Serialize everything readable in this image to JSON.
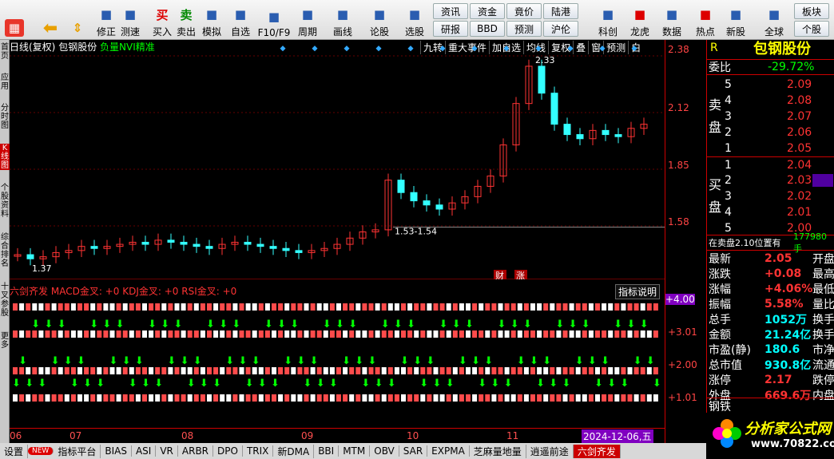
{
  "toolbar": {
    "items": [
      {
        "label": "修正",
        "icon": "edit-icon"
      },
      {
        "label": "测速",
        "icon": "speed-icon"
      },
      {
        "label": "买入",
        "icon": "buy-icon",
        "glyph": "买"
      },
      {
        "label": "卖出",
        "icon": "sell-icon",
        "glyph": "卖"
      },
      {
        "label": "模拟",
        "icon": "hammer-icon"
      },
      {
        "label": "自选",
        "icon": "star-icon"
      },
      {
        "label": "F10/F9",
        "icon": "f10-icon"
      },
      {
        "label": "周期",
        "icon": "clock-icon"
      },
      {
        "label": "画线",
        "icon": "pen-icon"
      },
      {
        "label": "论股",
        "icon": "discuss-icon"
      },
      {
        "label": "选股",
        "icon": "select-icon"
      },
      {
        "label": "科创",
        "icon": "kechuang-icon"
      },
      {
        "label": "龙虎",
        "icon": "dragon-icon"
      },
      {
        "label": "数据",
        "icon": "data-icon"
      },
      {
        "label": "热点",
        "icon": "hot-icon"
      },
      {
        "label": "新股",
        "icon": "newstock-icon"
      },
      {
        "label": "全球",
        "icon": "globe-icon"
      }
    ],
    "small": [
      [
        "资讯",
        "研报"
      ],
      [
        "资金",
        "BBD"
      ],
      [
        "竟价",
        "预测"
      ],
      [
        "陆港",
        "沪伦"
      ]
    ],
    "right_small": [
      "板块",
      "个股"
    ]
  },
  "left_tabs": [
    "首页",
    "应用",
    "分时图",
    "K线图",
    "个股资料",
    "综合排名",
    "十叉参股",
    "更多"
  ],
  "chart": {
    "period": "日线(复权)",
    "name": "包钢股份",
    "indicator": "负量NVI精准",
    "right_tools": [
      "九转",
      "重大事件",
      "加自选",
      "均线",
      "复权",
      "叠",
      "窗",
      "预测",
      "白"
    ],
    "annot_high": "2.33",
    "annot_low": "1.37",
    "annot_range": "1.53-1.54",
    "event_labels": [
      "财",
      "涨"
    ]
  },
  "price_axis": [
    "2.38",
    "2.12",
    "1.85",
    "1.58"
  ],
  "indicator": {
    "title": "六剑齐发",
    "macd": "MACD金叉: +0",
    "kdj": "KDJ金叉: +0",
    "rsi": "RSI金叉: +0",
    "btn": "指标说明",
    "axis": [
      "+4.00",
      "+3.01",
      "+2.00",
      "+1.01"
    ]
  },
  "dates": [
    "06",
    "07",
    "08",
    "09",
    "10",
    "11",
    "2024-12-06,五"
  ],
  "quote": {
    "r": "R",
    "name": "包钢股份",
    "wb_label": "委比",
    "wb": "-29.72%",
    "sell_label": [
      "卖",
      "盘"
    ],
    "buy_label": [
      "买",
      "盘"
    ],
    "sell": [
      [
        "5",
        "2.09"
      ],
      [
        "4",
        "2.08"
      ],
      [
        "3",
        "2.07"
      ],
      [
        "2",
        "2.06"
      ],
      [
        "1",
        "2.05"
      ]
    ],
    "buy": [
      [
        "1",
        "2.04"
      ],
      [
        "2",
        "2.03"
      ],
      [
        "3",
        "2.02"
      ],
      [
        "4",
        "2.01"
      ],
      [
        "5",
        "2.00"
      ]
    ],
    "note": "在卖盘2.10位置有",
    "note_val": "177980手",
    "stats": [
      [
        "最新",
        "2.05",
        "开盘"
      ],
      [
        "涨跌",
        "+0.08",
        "最高"
      ],
      [
        "涨幅",
        "+4.06%",
        "最低"
      ],
      [
        "振幅",
        "5.58%",
        "量比"
      ],
      [
        "总手",
        "1052万",
        "换手"
      ],
      [
        "金额",
        "21.24亿",
        "换手"
      ],
      [
        "市盈(静)",
        "180.6",
        "市净"
      ],
      [
        "总市值",
        "930.8亿",
        "流通"
      ],
      [
        "涨停",
        "2.17",
        "跌停"
      ],
      [
        "外盘",
        "669.6万",
        "内盘"
      ]
    ],
    "sector": "钢铁"
  },
  "tabs": [
    "设置",
    "NEW",
    "指标平台",
    "BIAS",
    "ASI",
    "VR",
    "ARBR",
    "DPO",
    "TRIX",
    "新DMA",
    "BBI",
    "MTM",
    "OBV",
    "SAR",
    "EXPMA",
    "芝麻量地量",
    "逍遥前途",
    "六剑齐发"
  ],
  "logo": {
    "text": "分析家公式网",
    "url": "www.70822.com"
  },
  "watermark": "分析家公式网www.70822.com",
  "colors": {
    "up": "#ff3333",
    "down": "#33ffff",
    "accent": "#c00000"
  },
  "chart_data": {
    "type": "candlestick",
    "x": [
      "06",
      "07",
      "08",
      "09",
      "10",
      "11",
      "12"
    ],
    "price_range": [
      1.37,
      2.38
    ],
    "series": [
      {
        "values": [
          1.42,
          1.4,
          1.41,
          1.43,
          1.44,
          1.46,
          1.45,
          1.46,
          1.47,
          1.48,
          1.47,
          1.49,
          1.48,
          1.47,
          1.46,
          1.45,
          1.47,
          1.48,
          1.47,
          1.46,
          1.45,
          1.44,
          1.43,
          1.44,
          1.45,
          1.47,
          1.5,
          1.53,
          1.54,
          1.78,
          1.72,
          1.68,
          1.66,
          1.64,
          1.67,
          1.7,
          1.75,
          1.8,
          1.95,
          2.15,
          2.33,
          2.2,
          2.05,
          2.0,
          1.98,
          2.02,
          2.0,
          1.99,
          2.03,
          2.05
        ]
      }
    ]
  }
}
